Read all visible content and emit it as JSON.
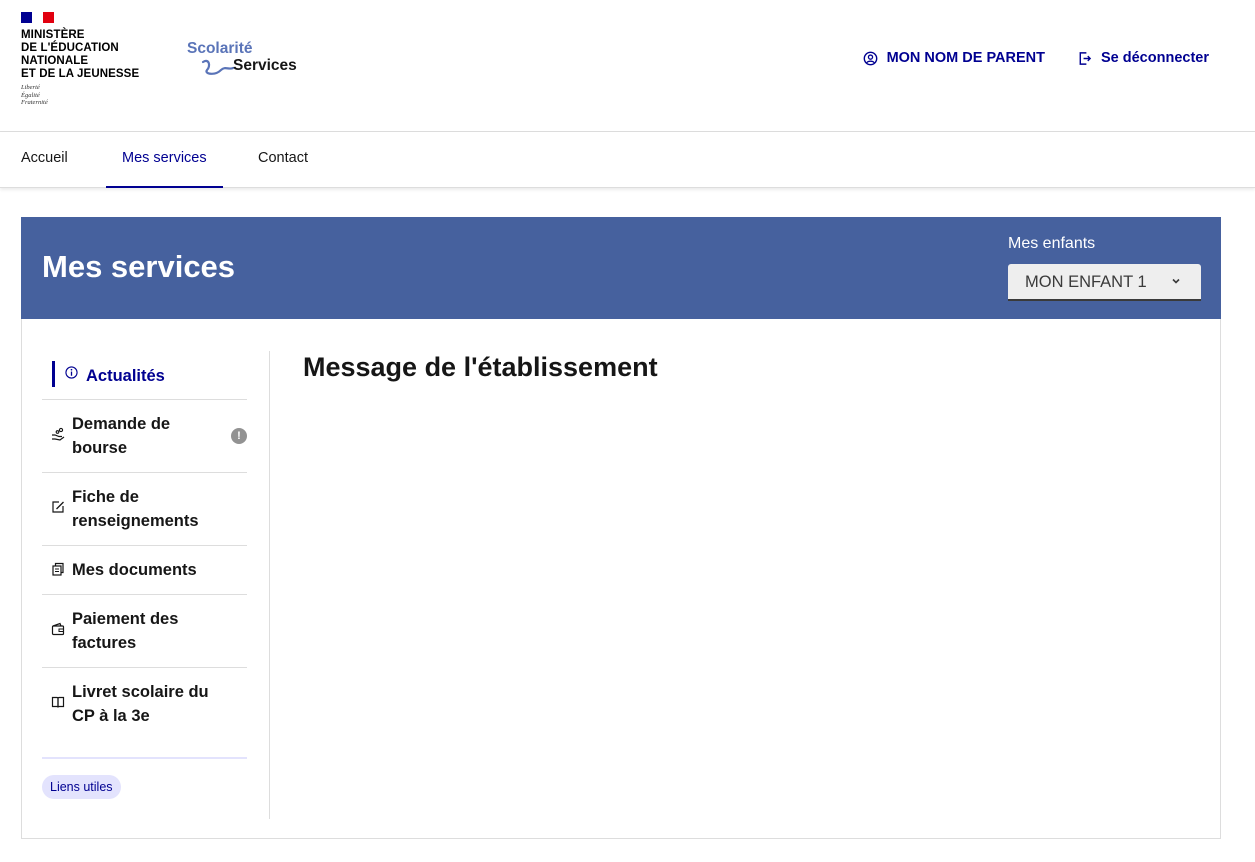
{
  "header": {
    "ministry_lines": [
      "MINISTÈRE",
      "DE L'ÉDUCATION",
      "NATIONALE",
      "ET DE LA JEUNESSE"
    ],
    "devise": [
      "Liberté",
      "Égalité",
      "Fraternité"
    ],
    "brand_line1": "Scolarité",
    "brand_line2": "Services",
    "user_label": "MON NOM DE PARENT",
    "logout_label": "Se déconnecter"
  },
  "nav": {
    "items": [
      {
        "label": "Accueil"
      },
      {
        "label": "Mes services"
      },
      {
        "label": "Contact"
      }
    ],
    "active_index": 1
  },
  "banner": {
    "title": "Mes services",
    "children_label": "Mes enfants",
    "selected_child": "MON ENFANT 1"
  },
  "sidebar": {
    "items": [
      {
        "label": "Actualités",
        "icon": "info-icon",
        "active": true
      },
      {
        "label": "Demande de bourse",
        "icon": "hand-coins-icon",
        "alert": "!"
      },
      {
        "label": "Fiche de renseignements",
        "icon": "edit-icon"
      },
      {
        "label": "Mes documents",
        "icon": "documents-icon"
      },
      {
        "label": "Paiement des factures",
        "icon": "wallet-icon"
      },
      {
        "label": "Livret scolaire du CP à la 3e",
        "icon": "book-icon"
      }
    ],
    "tag_label": "Liens utiles"
  },
  "content": {
    "title": "Message de l'établissement"
  },
  "colors": {
    "primary": "#000091",
    "banner": "#46619e",
    "brand_blue": "#5a74b8"
  }
}
